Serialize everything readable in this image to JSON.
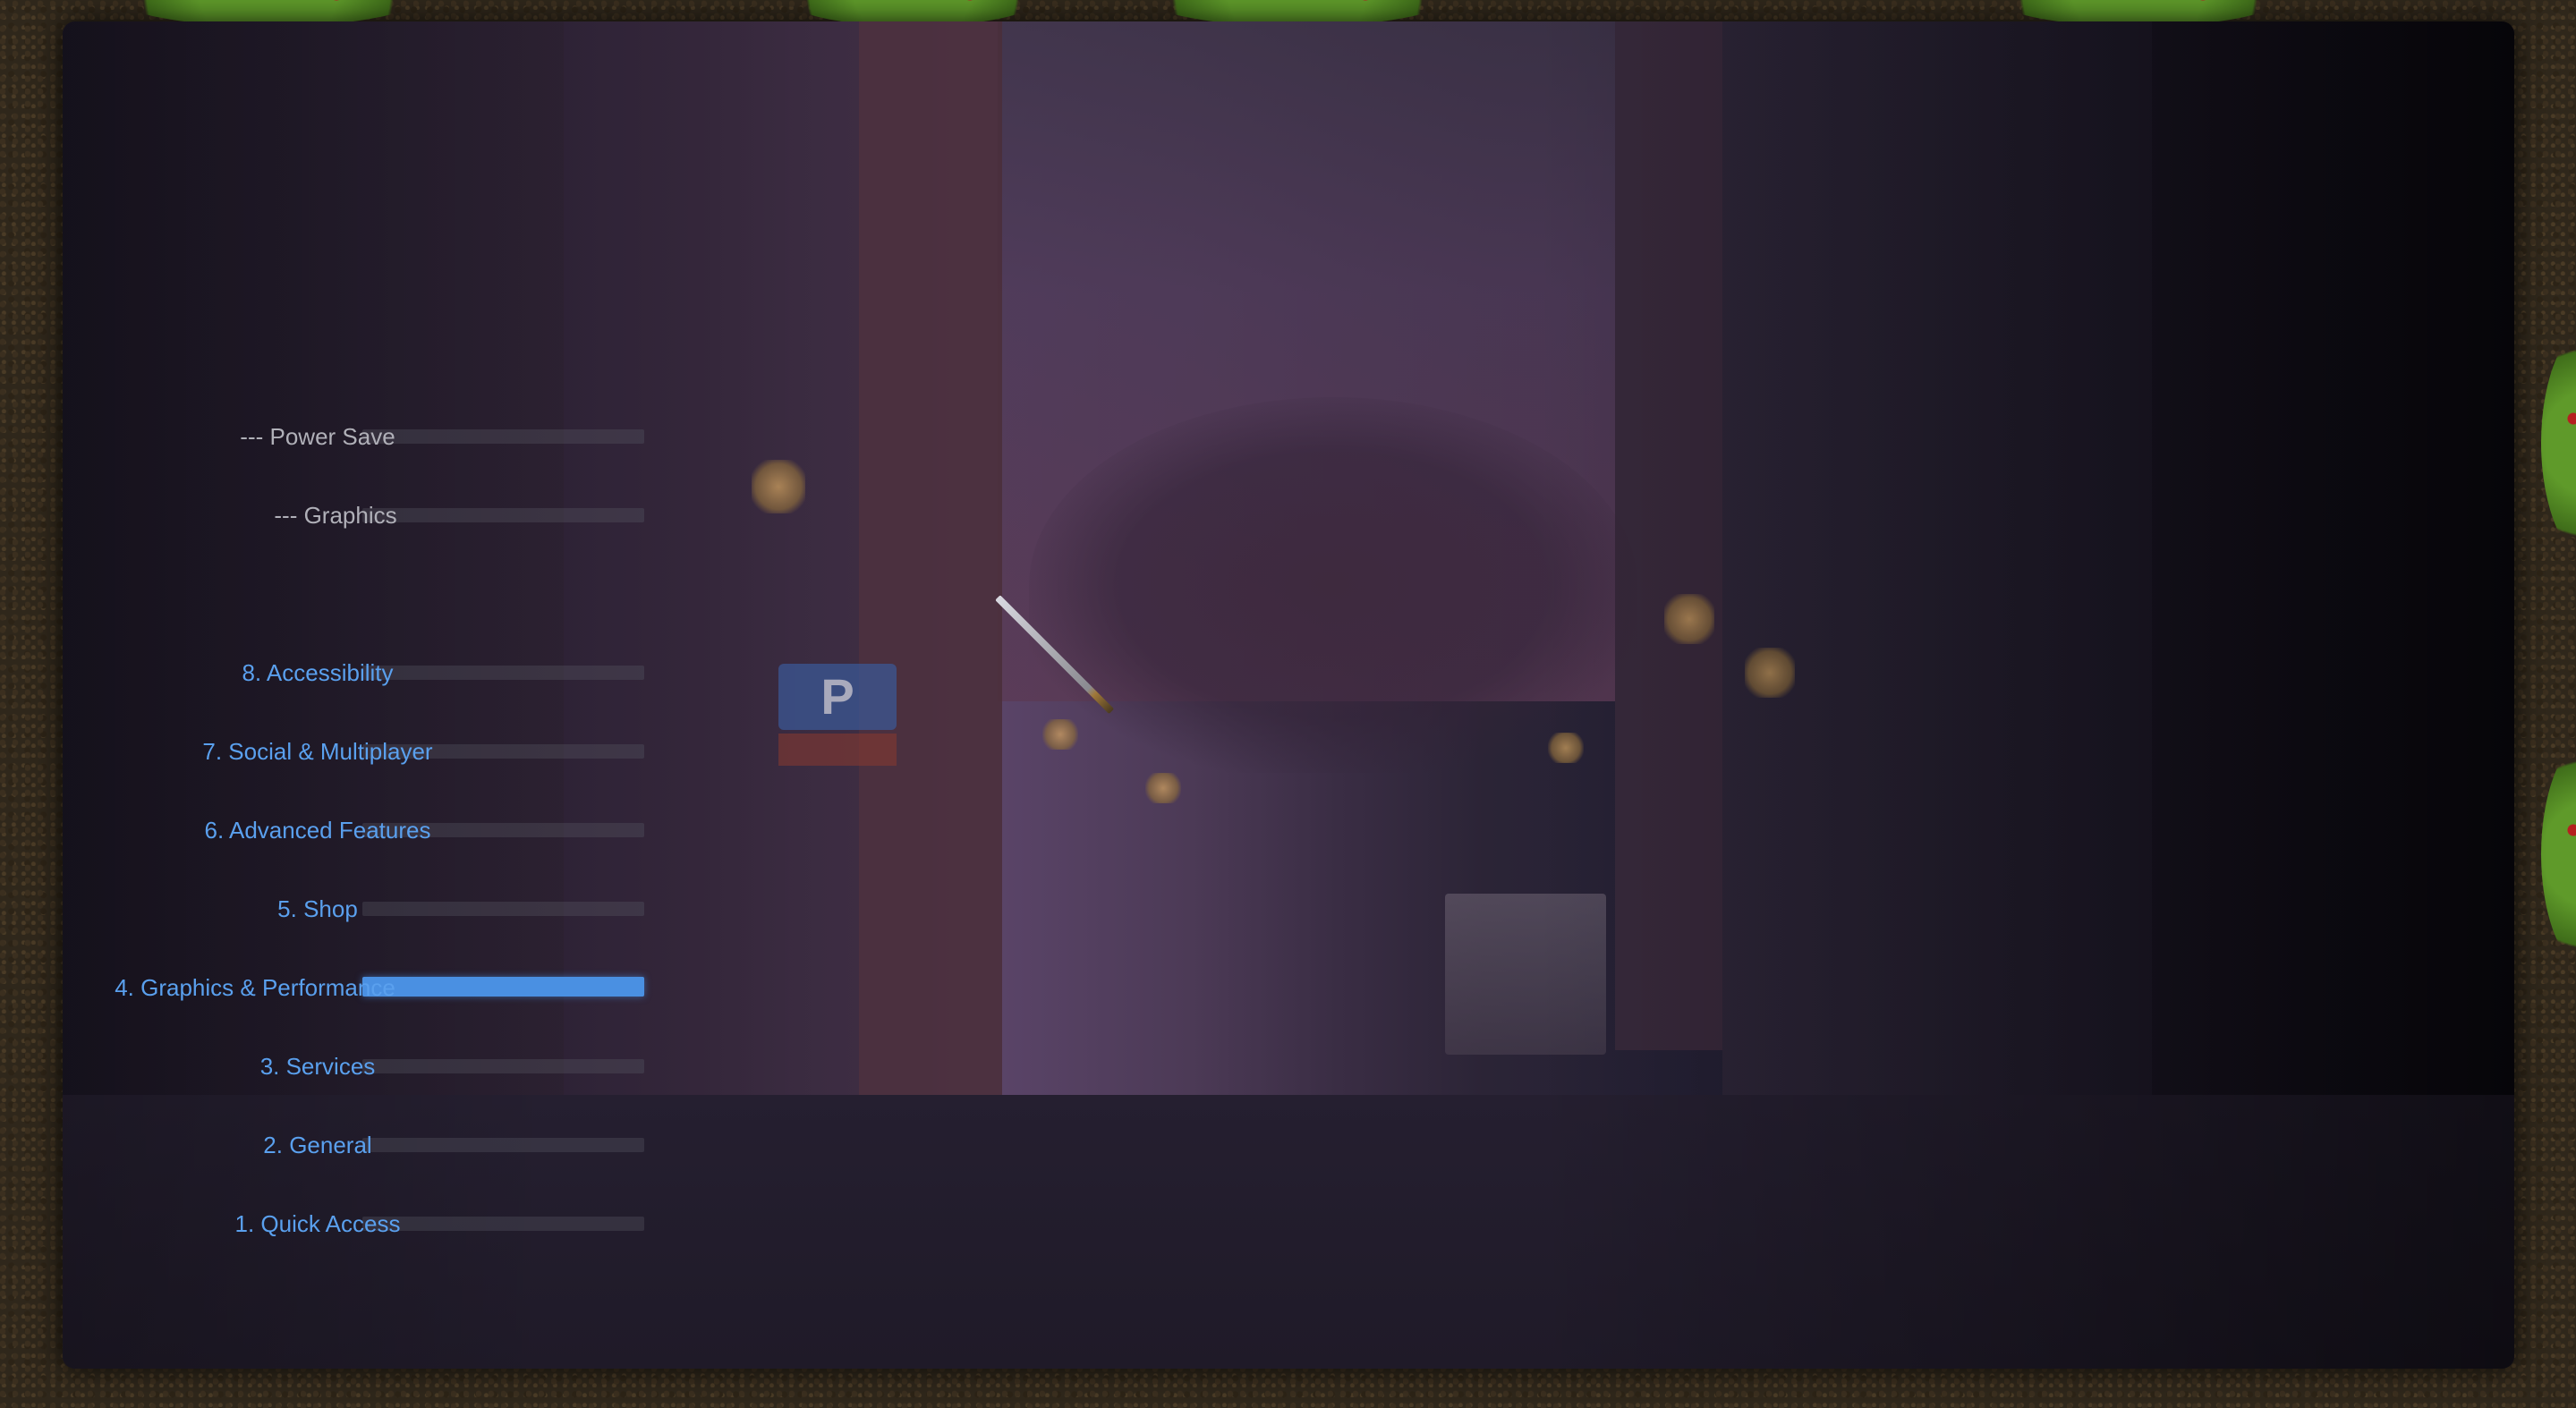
{
  "menu": {
    "items": [
      {
        "label": "--- Power Save",
        "style": "header"
      },
      {
        "label": "--- Graphics",
        "style": "header"
      },
      {
        "label": "8. Accessibility",
        "style": "link"
      },
      {
        "label": "7. Social & Multiplayer",
        "style": "link"
      },
      {
        "label": "6. Advanced Features",
        "style": "link"
      },
      {
        "label": "5. Shop",
        "style": "link"
      },
      {
        "label": "4. Graphics & Performance",
        "style": "link",
        "selected": true
      },
      {
        "label": "3. Services",
        "style": "link"
      },
      {
        "label": "2. General",
        "style": "link"
      },
      {
        "label": "1. Quick Access",
        "style": "link"
      }
    ],
    "accent_color": "#4a90e2",
    "link_color": "#5aa0ee",
    "header_color": "#b0b0b8"
  },
  "background": {
    "scene": "night city street",
    "parking_sign": "P"
  }
}
